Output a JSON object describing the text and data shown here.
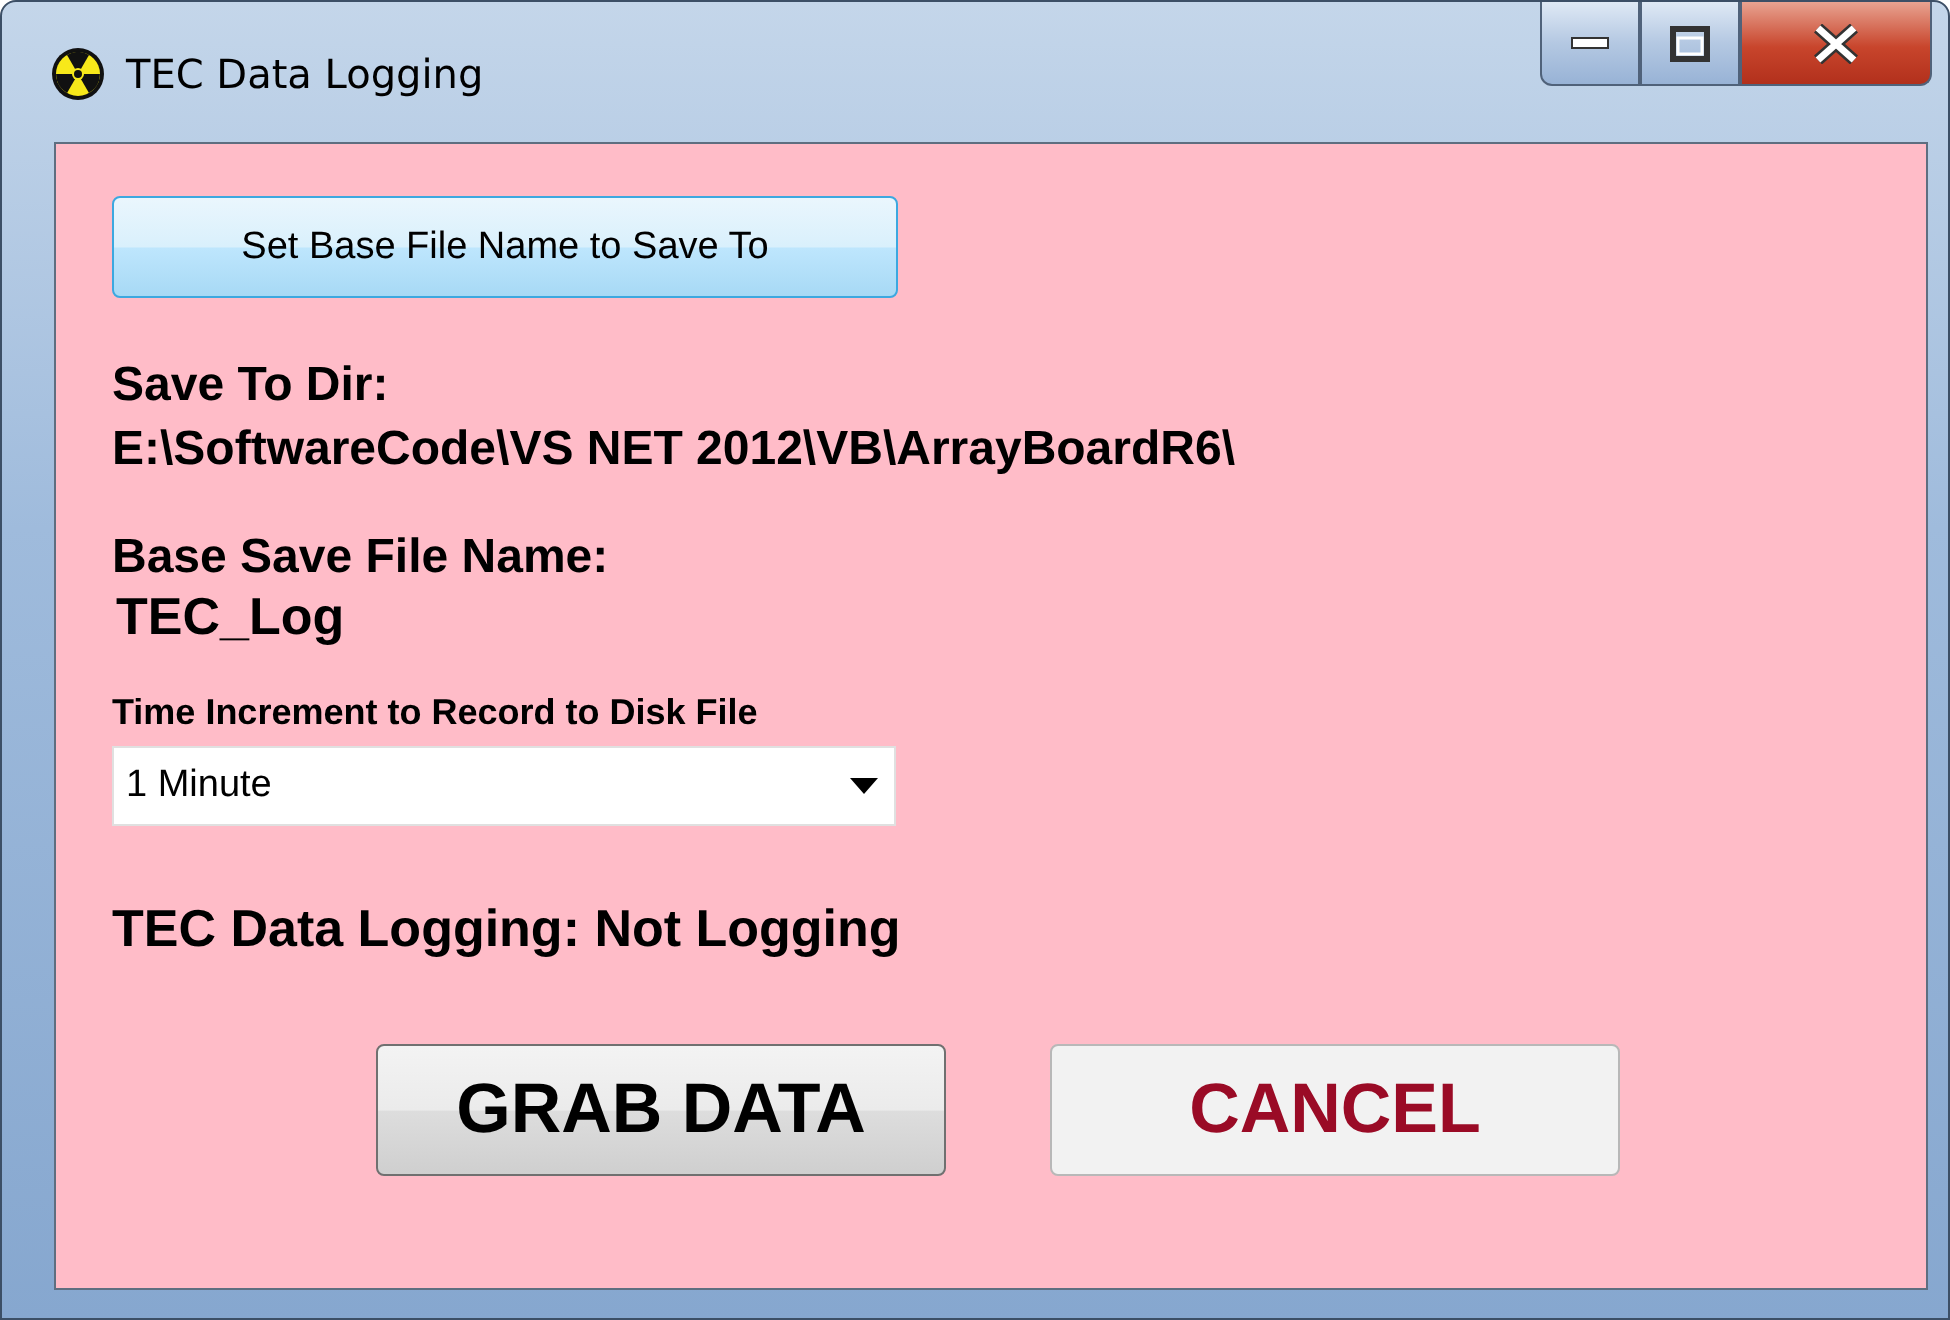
{
  "window": {
    "title": "TEC Data Logging"
  },
  "set_file_button": {
    "label": "Set Base File Name to Save To"
  },
  "save_dir": {
    "label": "Save To Dir:",
    "value": "E:\\SoftwareCode\\VS NET 2012\\VB\\ArrayBoardR6\\"
  },
  "base_name": {
    "label": "Base Save File Name:",
    "value": "TEC_Log"
  },
  "time_increment": {
    "label": "Time Increment to Record to Disk File",
    "value": "1 Minute"
  },
  "status": {
    "text": "TEC Data Logging: Not Logging"
  },
  "buttons": [
    {
      "label": "GRAB DATA",
      "kind": "primary"
    },
    {
      "label": "CANCEL",
      "kind": "cancel"
    }
  ]
}
